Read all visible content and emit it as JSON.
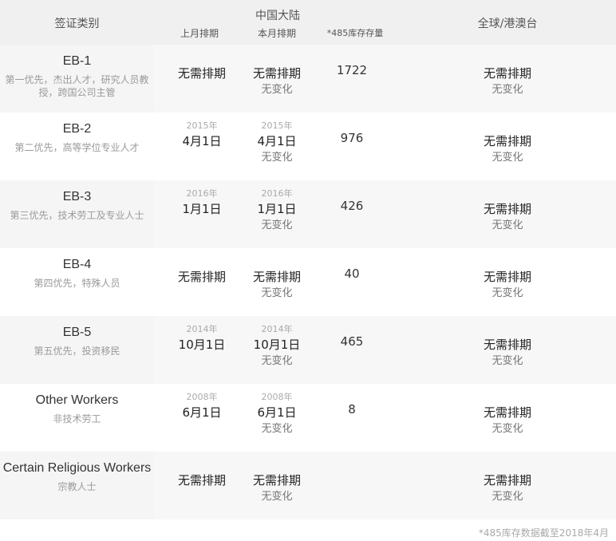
{
  "header": {
    "category": "签证类别",
    "china": "中国大陆",
    "last_month": "上月排期",
    "this_month": "本月排期",
    "stock": "*485库存存量",
    "global": "全球/港澳台"
  },
  "rows": [
    {
      "name": "EB-1",
      "desc": "第一优先，杰出人才，研究人员教授，跨国公司主管",
      "last": {
        "year": "",
        "main": "无需排期"
      },
      "this": {
        "year": "",
        "main": "无需排期",
        "sub": "无变化"
      },
      "stock": "1722",
      "global": {
        "main": "无需排期",
        "sub": "无变化"
      }
    },
    {
      "name": "EB-2",
      "desc": "第二优先，高等学位专业人才",
      "last": {
        "year": "2015年",
        "main": "4月1日"
      },
      "this": {
        "year": "2015年",
        "main": "4月1日",
        "sub": "无变化"
      },
      "stock": "976",
      "global": {
        "main": "无需排期",
        "sub": "无变化"
      }
    },
    {
      "name": "EB-3",
      "desc": "第三优先，技术劳工及专业人士",
      "last": {
        "year": "2016年",
        "main": "1月1日"
      },
      "this": {
        "year": "2016年",
        "main": "1月1日",
        "sub": "无变化"
      },
      "stock": "426",
      "global": {
        "main": "无需排期",
        "sub": "无变化"
      }
    },
    {
      "name": "EB-4",
      "desc": "第四优先，特殊人员",
      "last": {
        "year": "",
        "main": "无需排期"
      },
      "this": {
        "year": "",
        "main": "无需排期",
        "sub": "无变化"
      },
      "stock": "40",
      "global": {
        "main": "无需排期",
        "sub": "无变化"
      }
    },
    {
      "name": "EB-5",
      "desc": "第五优先，投资移民",
      "last": {
        "year": "2014年",
        "main": "10月1日"
      },
      "this": {
        "year": "2014年",
        "main": "10月1日",
        "sub": "无变化"
      },
      "stock": "465",
      "global": {
        "main": "无需排期",
        "sub": "无变化"
      }
    },
    {
      "name": "Other Workers",
      "desc": "非技术劳工",
      "last": {
        "year": "2008年",
        "main": "6月1日"
      },
      "this": {
        "year": "2008年",
        "main": "6月1日",
        "sub": "无变化"
      },
      "stock": "8",
      "global": {
        "main": "无需排期",
        "sub": "无变化"
      }
    },
    {
      "name": "Certain Religious Workers",
      "desc": "宗教人士",
      "last": {
        "year": "",
        "main": "无需排期"
      },
      "this": {
        "year": "",
        "main": "无需排期",
        "sub": "无变化"
      },
      "stock": "",
      "global": {
        "main": "无需排期",
        "sub": "无变化"
      }
    }
  ],
  "footnote": "*485库存数据截至2018年4月"
}
